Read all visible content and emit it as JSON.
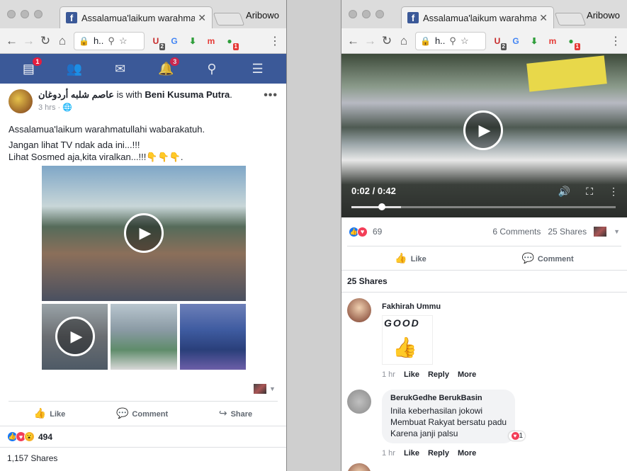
{
  "left": {
    "tab_title": "Assalamua'laikum warahmatullahi",
    "profile": "Aribowo",
    "omnibox": "h..",
    "nav_badges": {
      "messages": "1",
      "notifications": "3"
    },
    "extensions": [
      {
        "name": "ublock-icon",
        "glyph": "U",
        "color": "#c62828",
        "badge": "2",
        "badge_color": "#555"
      },
      {
        "name": "translate-icon",
        "glyph": "G",
        "color": "#4285f4",
        "badge": "",
        "badge_color": "#555"
      },
      {
        "name": "download-icon",
        "glyph": "⬇",
        "color": "#2e9e3a",
        "badge": "",
        "badge_color": "#555"
      },
      {
        "name": "m-icon",
        "glyph": "m",
        "color": "#e53935",
        "badge": "",
        "badge_color": "#555"
      },
      {
        "name": "green-ext-icon",
        "glyph": "●",
        "color": "#2e9e3a",
        "badge": "1",
        "badge_color": "#e53935"
      }
    ],
    "post": {
      "author": "عاصم شلبه أردوغان",
      "with_text": " is with ",
      "tagged": "Beni Kusuma Putra",
      "period": ".",
      "time": "3 hrs · ",
      "lines": [
        "Assalamua'laikum warahmatullahi wabarakatuh.",
        "Jangan lihat TV ndak ada ini...!!!",
        "Lihat Sosmed aja,kita viralkan...!!!👇👇👇."
      ],
      "like_label": "Like",
      "comment_label": "Comment",
      "share_label": "Share",
      "reactions_count": "494",
      "shares": "1,157 Shares"
    }
  },
  "right": {
    "tab_title": "Assalamua'laikum warahmatullahi",
    "profile": "Aribowo",
    "omnibox": "h..",
    "video_time": "0:02 / 0:42",
    "video_progress_fraction": 0.048,
    "reactions_count": "69",
    "comments_count": "6 Comments",
    "shares_count": "25 Shares",
    "like_label": "Like",
    "comment_label": "Comment",
    "shares_header": "25 Shares",
    "comments": [
      {
        "name": "Fakhirah Ummu",
        "sticker_text": "GOOD",
        "time": "1 hr",
        "like": "Like",
        "reply": "Reply",
        "more": "More"
      },
      {
        "name": "BerukGedhe BerukBasin",
        "lines": [
          "Inila keberhasilan jokowi",
          "Membuat Rakyat bersatu padu",
          "Karena janji palsu"
        ],
        "reaction_count": "1",
        "time": "1 hr",
        "like": "Like",
        "reply": "Reply",
        "more": "More"
      }
    ]
  }
}
